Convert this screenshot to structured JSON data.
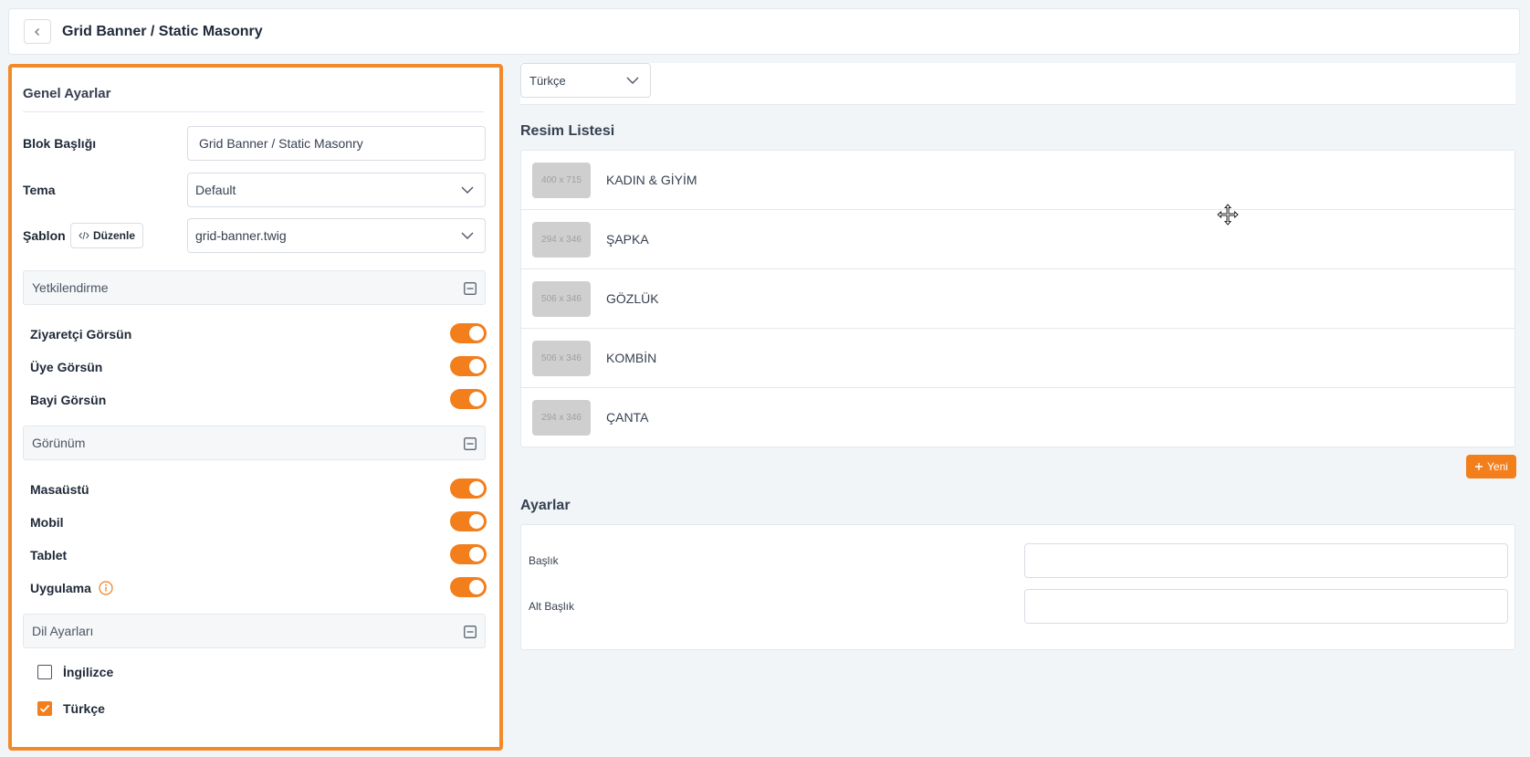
{
  "header": {
    "title": "Grid Banner / Static Masonry"
  },
  "general": {
    "title": "Genel Ayarlar",
    "block_title_label": "Blok Başlığı",
    "block_title_value": "Grid Banner / Static Masonry",
    "theme_label": "Tema",
    "theme_value": "Default",
    "template_label": "Şablon",
    "edit_button": "Düzenle",
    "template_value": "grid-banner.twig"
  },
  "authorization": {
    "title": "Yetkilendirme",
    "items": [
      {
        "label": "Ziyaretçi Görsün",
        "on": true
      },
      {
        "label": "Üye Görsün",
        "on": true
      },
      {
        "label": "Bayi Görsün",
        "on": true
      }
    ]
  },
  "view": {
    "title": "Görünüm",
    "items": [
      {
        "label": "Masaüstü",
        "on": true
      },
      {
        "label": "Mobil",
        "on": true
      },
      {
        "label": "Tablet",
        "on": true
      },
      {
        "label": "Uygulama",
        "on": true
      }
    ]
  },
  "language_settings": {
    "title": "Dil Ayarları",
    "items": [
      {
        "label": "İngilizce",
        "checked": false
      },
      {
        "label": "Türkçe",
        "checked": true
      }
    ]
  },
  "language_select": {
    "value": "Türkçe"
  },
  "image_list": {
    "title": "Resim Listesi",
    "items": [
      {
        "size": "400 x 715",
        "label": "KADIN & GİYİM"
      },
      {
        "size": "294 x 346",
        "label": "ŞAPKA"
      },
      {
        "size": "506 x 346",
        "label": "GÖZLÜK"
      },
      {
        "size": "506 x 346",
        "label": "KOMBİN"
      },
      {
        "size": "294 x 346",
        "label": "ÇANTA"
      }
    ],
    "new_button": "Yeni"
  },
  "settings": {
    "title": "Ayarlar",
    "title_label": "Başlık",
    "title_value": "",
    "subtitle_label": "Alt Başlık",
    "subtitle_value": ""
  },
  "colors": {
    "accent": "#f27e1c",
    "panel_border": "#f28a2a"
  },
  "icons": {
    "back": "chevron-left-icon",
    "collapse": "minus-square-icon",
    "code": "code-icon",
    "info": "info-circle-icon",
    "move": "move-icon",
    "add": "plus-icon"
  }
}
